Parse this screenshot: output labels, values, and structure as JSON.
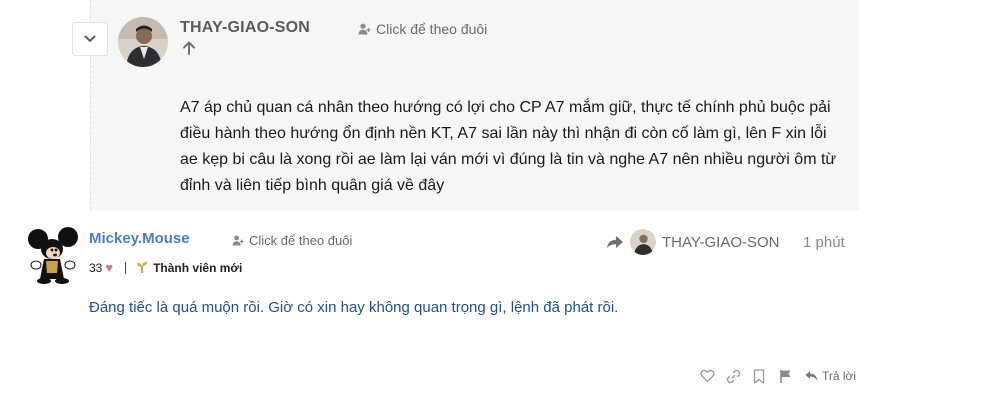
{
  "quoted_post": {
    "author": "THAY-GIAO-SON",
    "follow_label": "Click để theo đuôi",
    "body": "A7 áp chủ quan cá nhân theo hướng có lợi cho CP A7 mắm giữ, thực tế chính phủ buộc pải điều hành theo hướng ổn định nền KT, A7 sai lần này thì nhận đi còn cố làm gì, lên F xin lỗi ae kẹp bi câu là xong rồi ae làm lại ván mới vì đúng là tin và nghe A7 nên nhiều người ôm từ đỉnh và liên tiếp bình quân giá về đây"
  },
  "post": {
    "author": "Mickey.Mouse",
    "follow_label": "Click để theo đuôi",
    "score": "33",
    "rank": "Thành viên mới",
    "reply_to_author": "THAY-GIAO-SON",
    "time": "1 phút",
    "body": "Đáng tiếc là quá muộn rồi. Giờ có xin hay không quan trọng gì, lệnh đã phát rồi.",
    "reply_label": "Trả lời"
  },
  "icons": {
    "collapse": "chevron-down-icon",
    "upvote": "arrow-up-icon",
    "follow": "user-plus-icon",
    "reply_to": "share-arrow-icon",
    "heart": "heart-icon",
    "rank": "sprout-icon",
    "like": "heart-outline-icon",
    "link": "link-icon",
    "bookmark": "bookmark-icon",
    "flag": "flag-icon",
    "reply": "reply-arrow-icon"
  },
  "colors": {
    "author_link": "#4a7fc9",
    "post_text": "#1d4f9a",
    "heart": "#e0708a",
    "quote_bg": "#f6f6f6"
  }
}
